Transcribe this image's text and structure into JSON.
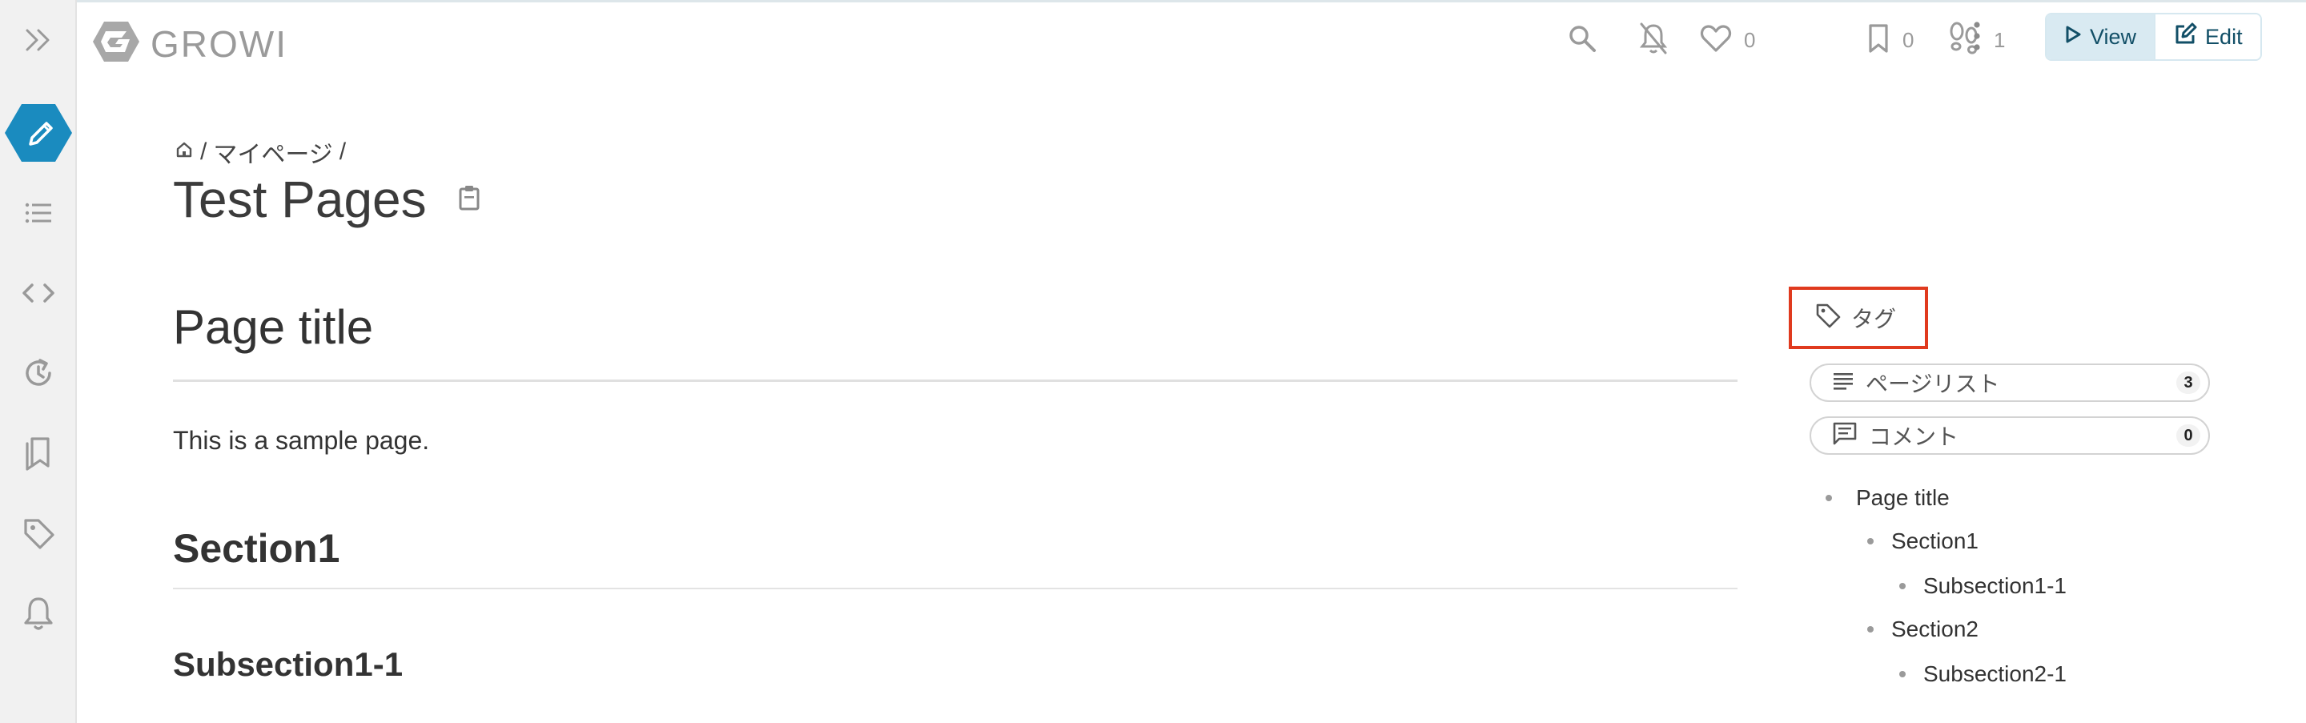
{
  "app": {
    "name": "GROWI"
  },
  "toolbar": {
    "like_count": "0",
    "bookmark_count": "0",
    "seen_count": "1",
    "view_label": "View",
    "edit_label": "Edit"
  },
  "breadcrumb": {
    "separator1": "/",
    "parent": "マイページ",
    "separator2": "/"
  },
  "page": {
    "title": "Test Pages",
    "heading1": "Page title",
    "paragraph": "This is a sample page.",
    "heading2": "Section1",
    "heading3": "Subsection1-1"
  },
  "side_panel": {
    "tag_label": "タグ",
    "page_list_label": "ページリスト",
    "page_list_count": "3",
    "comment_label": "コメント",
    "comment_count": "0",
    "toc": [
      {
        "label": "Page title",
        "level": 1
      },
      {
        "label": "Section1",
        "level": 2
      },
      {
        "label": "Subsection1-1",
        "level": 3
      },
      {
        "label": "Section2",
        "level": 2
      },
      {
        "label": "Subsection2-1",
        "level": 3
      }
    ]
  },
  "sidebar": {
    "items": [
      {
        "icon": "expand-sidebar-icon"
      },
      {
        "icon": "create-page-icon"
      },
      {
        "icon": "list-icon"
      },
      {
        "icon": "code-icon"
      },
      {
        "icon": "history-icon"
      },
      {
        "icon": "bookmarks-icon"
      },
      {
        "icon": "tag-icon"
      },
      {
        "icon": "notification-bell-icon"
      }
    ]
  },
  "colors": {
    "accent": "#1a8bbf",
    "highlight_box": "#e03a1e",
    "sidebar_bg": "#f1f1f1"
  }
}
